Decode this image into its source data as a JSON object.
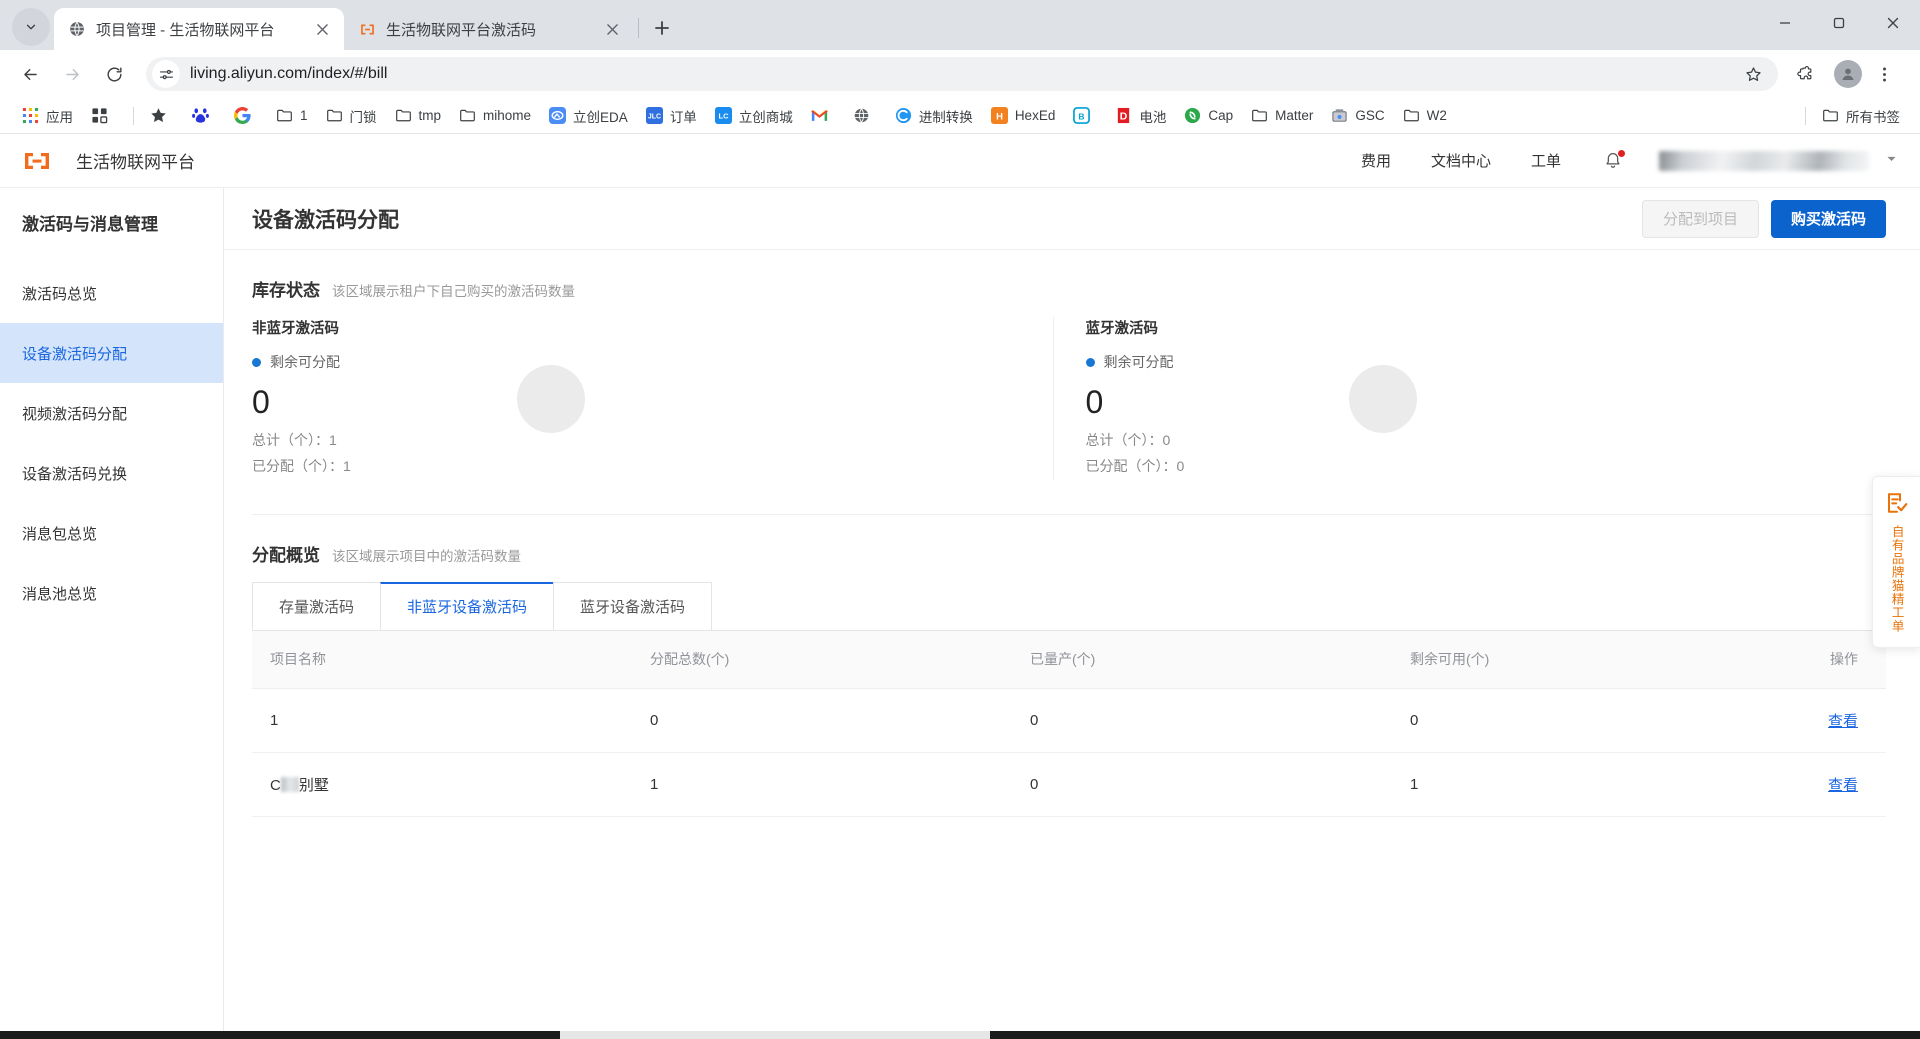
{
  "browser": {
    "tabs": [
      {
        "title": "项目管理 - 生活物联网平台",
        "favicon": "globe-icon",
        "active": true
      },
      {
        "title": "生活物联网平台激活码",
        "favicon": "aliyun-living-icon",
        "active": false
      }
    ],
    "new_tab_label": "+",
    "url": "living.aliyun.com/index/#/bill",
    "window_controls": {
      "minimize": "–",
      "maximize": "▢",
      "close": "✕"
    },
    "bookmarks": [
      {
        "label": "应用",
        "icon": "apps-grid-icon"
      },
      {
        "label": "",
        "icon": "apps-squares-icon"
      },
      {
        "label": "",
        "icon": "star-icon"
      },
      {
        "label": "",
        "icon": "baidu-icon"
      },
      {
        "label": "",
        "icon": "google-icon"
      },
      {
        "label": "1",
        "icon": "folder-icon"
      },
      {
        "label": "门锁",
        "icon": "folder-icon"
      },
      {
        "label": "tmp",
        "icon": "folder-icon"
      },
      {
        "label": "mihome",
        "icon": "folder-icon"
      },
      {
        "label": "立创EDA",
        "icon": "lceda-icon"
      },
      {
        "label": "订单",
        "icon": "jlc-icon"
      },
      {
        "label": "立创商城",
        "icon": "lcsc-icon"
      },
      {
        "label": "",
        "icon": "gmail-icon"
      },
      {
        "label": "",
        "icon": "globe-icon"
      },
      {
        "label": "进制转换",
        "icon": "converter-icon"
      },
      {
        "label": "HexEd",
        "icon": "hexed-icon"
      },
      {
        "label": "",
        "icon": "bilibili-icon"
      },
      {
        "label": "电池",
        "icon": "d-icon"
      },
      {
        "label": "Cap",
        "icon": "cap-icon"
      },
      {
        "label": "Matter",
        "icon": "folder-icon"
      },
      {
        "label": "GSC",
        "icon": "gsc-icon"
      },
      {
        "label": "W2",
        "icon": "folder-icon"
      }
    ],
    "all_bookmarks_label": "所有书签"
  },
  "appbar": {
    "logo": "aliyun-living-logo",
    "brand": "生活物联网平台",
    "nav": [
      {
        "label": "费用"
      },
      {
        "label": "文档中心"
      },
      {
        "label": "工单"
      }
    ],
    "notification_icon": "bell-icon",
    "account_name": "",
    "caret_icon": "chevron-down-icon"
  },
  "sidebar": {
    "title": "激活码与消息管理",
    "items": [
      {
        "label": "激活码总览",
        "active": false
      },
      {
        "label": "设备激活码分配",
        "active": true
      },
      {
        "label": "视频激活码分配",
        "active": false
      },
      {
        "label": "设备激活码兑换",
        "active": false
      },
      {
        "label": "消息包总览",
        "active": false
      },
      {
        "label": "消息池总览",
        "active": false
      }
    ]
  },
  "content": {
    "title": "设备激活码分配",
    "assign_button": "分配到项目",
    "buy_button": "购买激活码",
    "inventory": {
      "title": "库存状态",
      "subtitle": "该区域展示租户下自己购买的激活码数量",
      "cards": [
        {
          "name": "非蓝牙激活码",
          "legend": "剩余可分配",
          "value": "0",
          "total_label": "总计（个）：1",
          "allocated_label": "已分配（个）：1"
        },
        {
          "name": "蓝牙激活码",
          "legend": "剩余可分配",
          "value": "0",
          "total_label": "总计（个）：0",
          "allocated_label": "已分配（个）：0"
        }
      ]
    },
    "allocation": {
      "title": "分配概览",
      "subtitle": "该区域展示项目中的激活码数量",
      "tabs": [
        {
          "label": "存量激活码",
          "selected": false
        },
        {
          "label": "非蓝牙设备激活码",
          "selected": true
        },
        {
          "label": "蓝牙设备激活码",
          "selected": false
        }
      ],
      "table": {
        "columns": [
          "项目名称",
          "分配总数(个)",
          "已量产(个)",
          "剩余可用(个)",
          "操作"
        ],
        "rows": [
          {
            "name": "1",
            "total": "0",
            "produced": "0",
            "remaining": "0",
            "action": "查看",
            "masked": false
          },
          {
            "name": "C别墅",
            "total": "1",
            "produced": "0",
            "remaining": "1",
            "action": "查看",
            "masked": true
          }
        ]
      }
    }
  },
  "float_widget": {
    "icon": "form-check-icon",
    "text": "自有品牌猫精工单",
    "accent": "#e8730a"
  },
  "colors": {
    "primary": "#0b63ce",
    "link": "#1a66e0",
    "sidebar_active_bg": "#d4e4fb",
    "brand_orange": "#f26c1d",
    "notification_red": "#e02020"
  }
}
